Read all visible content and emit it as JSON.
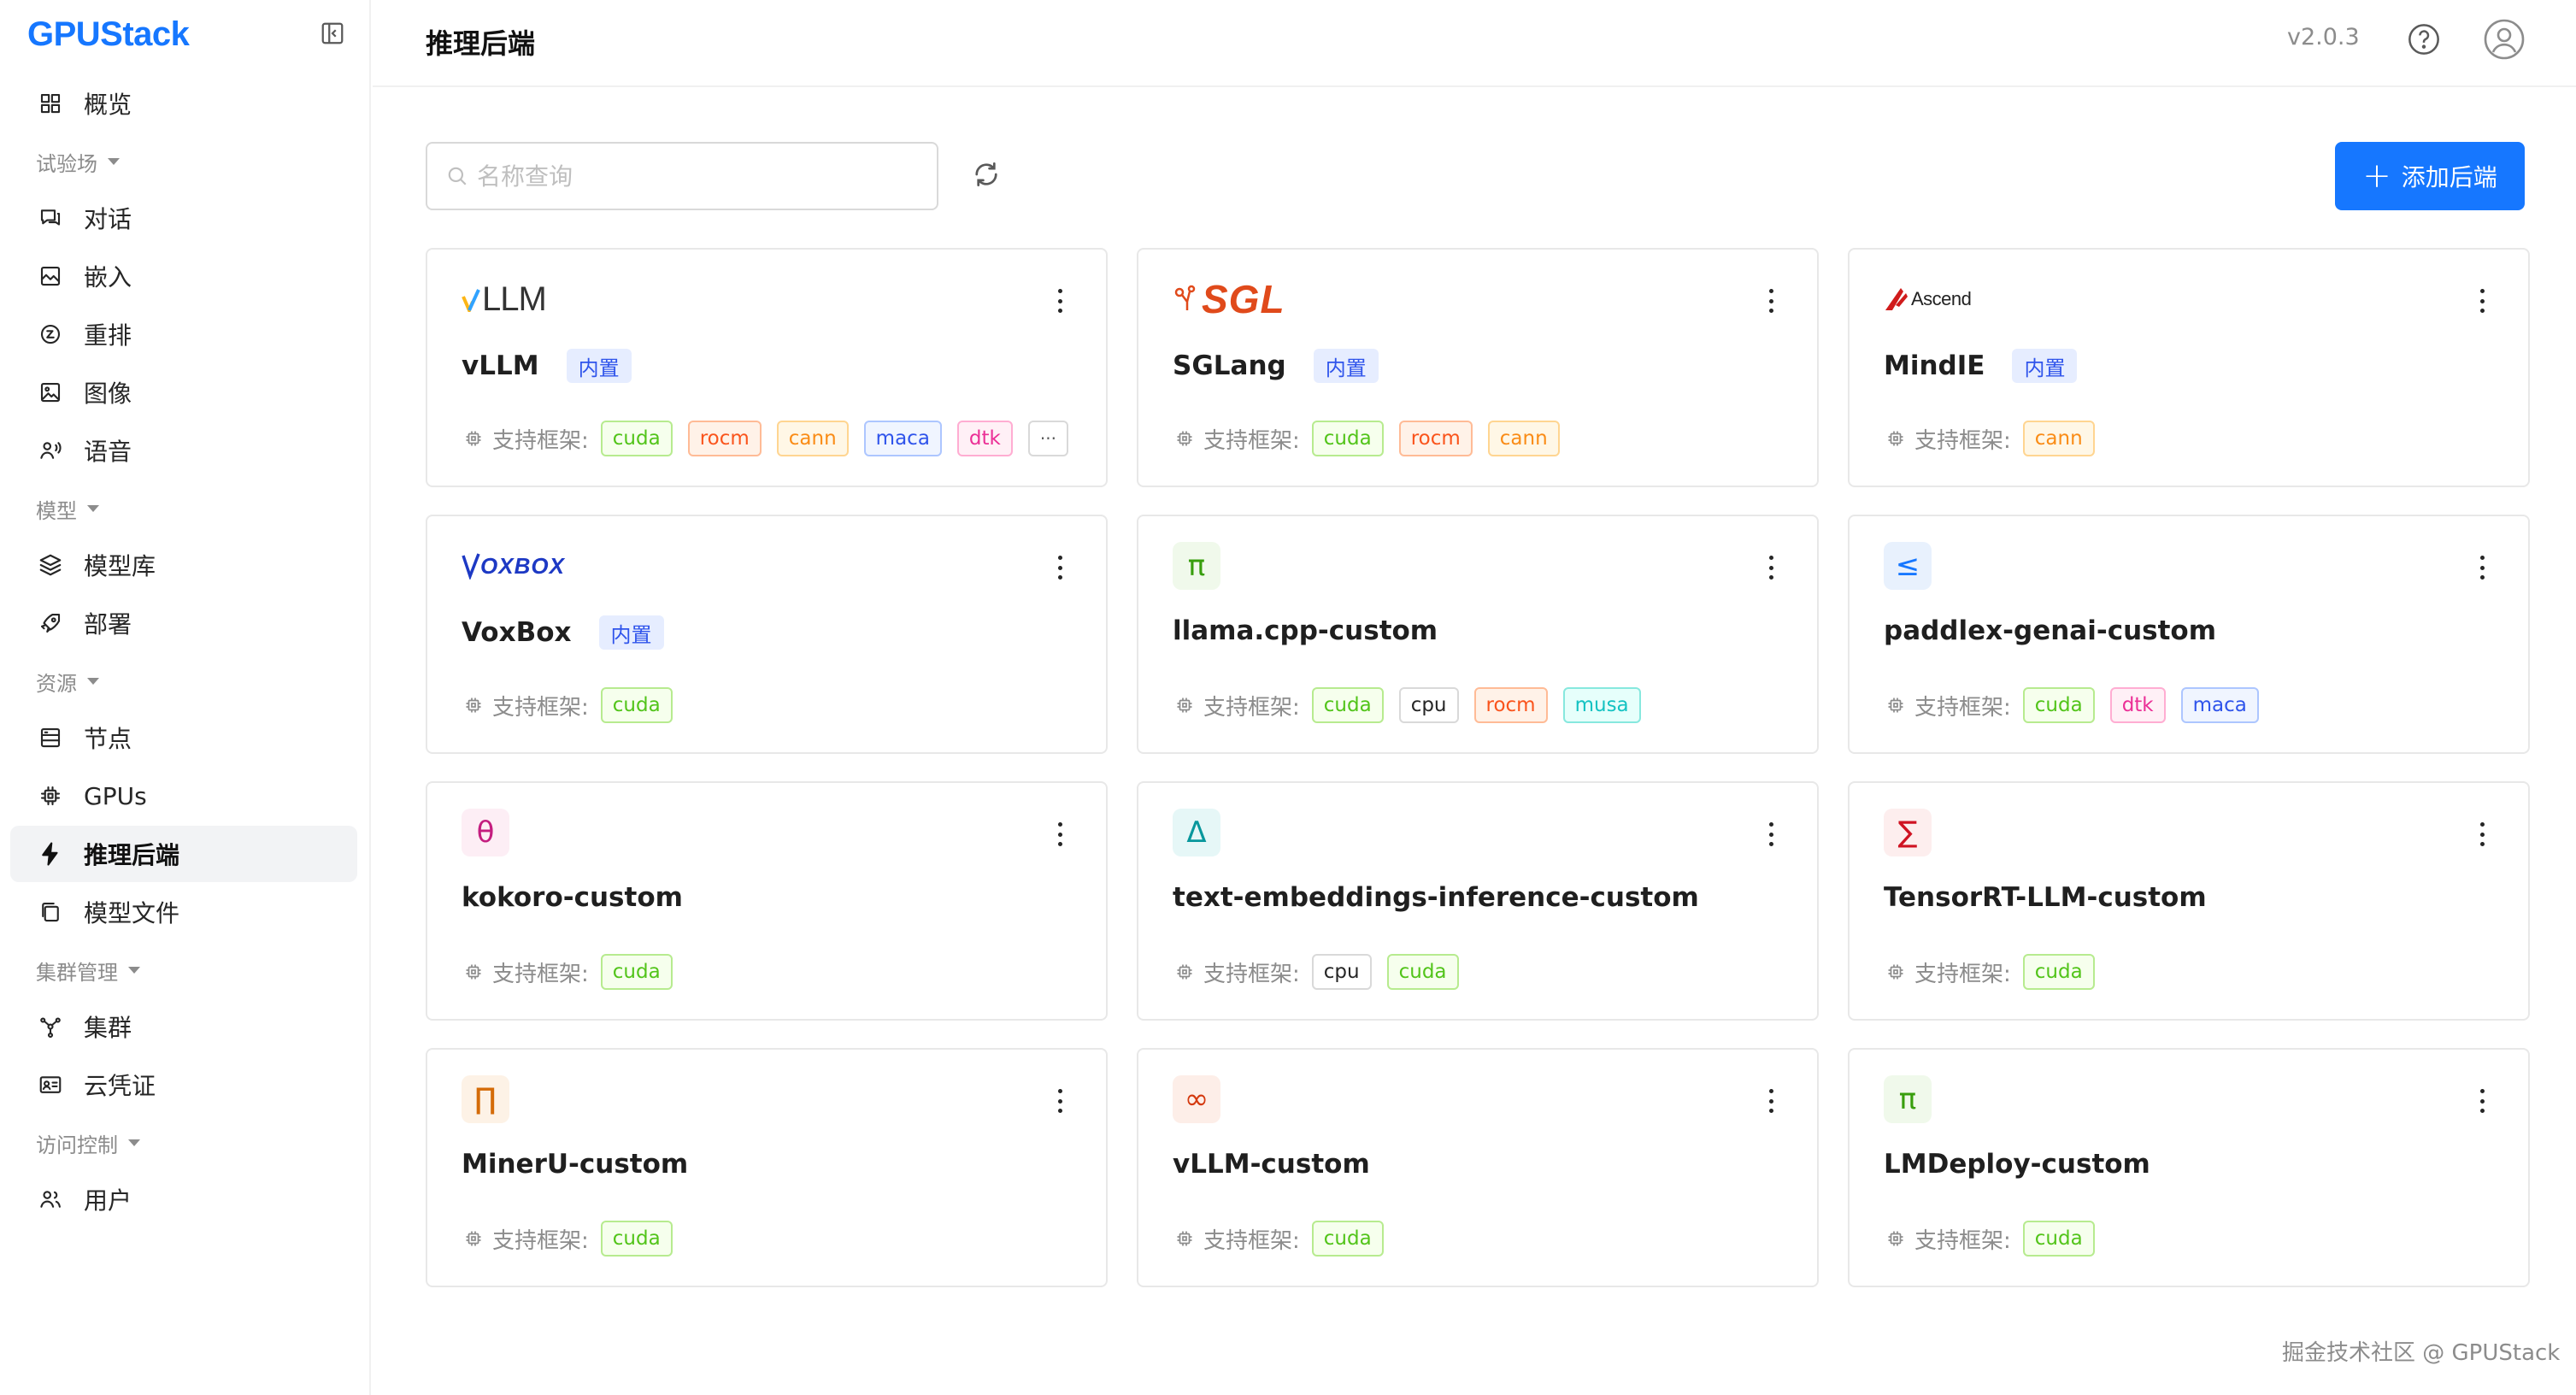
{
  "app": {
    "brand": "GPUStack",
    "version": "v2.0.3"
  },
  "sidebar": {
    "sections": [
      {
        "type": "item",
        "label": "概览",
        "icon": "dashboard-icon"
      },
      {
        "type": "group",
        "label": "试验场"
      },
      {
        "type": "item",
        "label": "对话",
        "icon": "chat-icon"
      },
      {
        "type": "item",
        "label": "嵌入",
        "icon": "embedding-icon"
      },
      {
        "type": "item",
        "label": "重排",
        "icon": "rerank-icon"
      },
      {
        "type": "item",
        "label": "图像",
        "icon": "image-icon"
      },
      {
        "type": "item",
        "label": "语音",
        "icon": "voice-icon"
      },
      {
        "type": "group",
        "label": "模型"
      },
      {
        "type": "item",
        "label": "模型库",
        "icon": "layers-icon"
      },
      {
        "type": "item",
        "label": "部署",
        "icon": "rocket-icon"
      },
      {
        "type": "group",
        "label": "资源"
      },
      {
        "type": "item",
        "label": "节点",
        "icon": "server-icon"
      },
      {
        "type": "item",
        "label": "GPUs",
        "icon": "chip-icon"
      },
      {
        "type": "item",
        "label": "推理后端",
        "icon": "lightning-icon",
        "active": true
      },
      {
        "type": "item",
        "label": "模型文件",
        "icon": "files-icon"
      },
      {
        "type": "group",
        "label": "集群管理"
      },
      {
        "type": "item",
        "label": "集群",
        "icon": "cluster-icon"
      },
      {
        "type": "item",
        "label": "云凭证",
        "icon": "credential-icon"
      },
      {
        "type": "group",
        "label": "访问控制"
      },
      {
        "type": "item",
        "label": "用户",
        "icon": "users-icon"
      }
    ]
  },
  "header": {
    "title": "推理后端"
  },
  "toolbar": {
    "search_placeholder": "名称查询",
    "search_value": "",
    "add_label": "添加后端"
  },
  "labels": {
    "framework": "支持框架:",
    "builtin": "内置"
  },
  "colors": {
    "primary": "#1677ff",
    "tag_cuda": "#52c41a",
    "tag_rocm": "#fa541c",
    "tag_cann": "#fa8c16",
    "tag_maca": "#2f54eb",
    "tag_dtk": "#eb2f96",
    "tag_musa": "#13c2c2",
    "tag_cpu": "#262626"
  },
  "backends": [
    {
      "name": "vLLM",
      "builtin": true,
      "logo": "vllm-logo",
      "logo_text": "LLM",
      "frameworks": [
        "cuda",
        "rocm",
        "cann",
        "maca",
        "dtk",
        "···"
      ]
    },
    {
      "name": "SGLang",
      "builtin": true,
      "logo": "sglang-logo",
      "logo_text": "SGL",
      "frameworks": [
        "cuda",
        "rocm",
        "cann"
      ]
    },
    {
      "name": "MindIE",
      "builtin": true,
      "logo": "ascend-logo",
      "logo_text": "Ascend",
      "frameworks": [
        "cann"
      ]
    },
    {
      "name": "VoxBox",
      "builtin": true,
      "logo": "voxbox-logo",
      "logo_text": "OXBOX",
      "frameworks": [
        "cuda"
      ]
    },
    {
      "name": "llama.cpp-custom",
      "builtin": false,
      "logo": "pi-icon",
      "symbol": "π",
      "sym_color": "#389e0d",
      "sym_bg": "#f0f9eb",
      "frameworks": [
        "cuda",
        "cpu",
        "rocm",
        "musa"
      ]
    },
    {
      "name": "paddlex-genai-custom",
      "builtin": false,
      "logo": "less-equal-icon",
      "symbol": "≤",
      "sym_color": "#1677ff",
      "sym_bg": "#e8f1fd",
      "frameworks": [
        "cuda",
        "dtk",
        "maca"
      ]
    },
    {
      "name": "kokoro-custom",
      "builtin": false,
      "logo": "theta-icon",
      "symbol": "θ",
      "sym_color": "#c41d7f",
      "sym_bg": "#fdeef5",
      "frameworks": [
        "cuda"
      ]
    },
    {
      "name": "text-embeddings-inference-custom",
      "builtin": false,
      "logo": "delta-icon",
      "symbol": "Δ",
      "sym_color": "#08979c",
      "sym_bg": "#e6f7f7",
      "frameworks": [
        "cpu",
        "cuda"
      ]
    },
    {
      "name": "TensorRT-LLM-custom",
      "builtin": false,
      "logo": "sigma-icon",
      "symbol": "∑",
      "sym_color": "#cf1322",
      "sym_bg": "#fdeeee",
      "frameworks": [
        "cuda"
      ]
    },
    {
      "name": "MinerU-custom",
      "builtin": false,
      "logo": "product-icon",
      "symbol": "∏",
      "sym_color": "#d46b08",
      "sym_bg": "#fdf2e6",
      "frameworks": [
        "cuda"
      ]
    },
    {
      "name": "vLLM-custom",
      "builtin": false,
      "logo": "infinity-icon",
      "symbol": "∞",
      "sym_color": "#d4380d",
      "sym_bg": "#fdeee8",
      "frameworks": [
        "cuda"
      ]
    },
    {
      "name": "LMDeploy-custom",
      "builtin": false,
      "logo": "pi-icon",
      "symbol": "π",
      "sym_color": "#389e0d",
      "sym_bg": "#f0f9eb",
      "frameworks": [
        "cuda"
      ]
    }
  ],
  "watermark": "掘金技术社区 @ GPUStack"
}
